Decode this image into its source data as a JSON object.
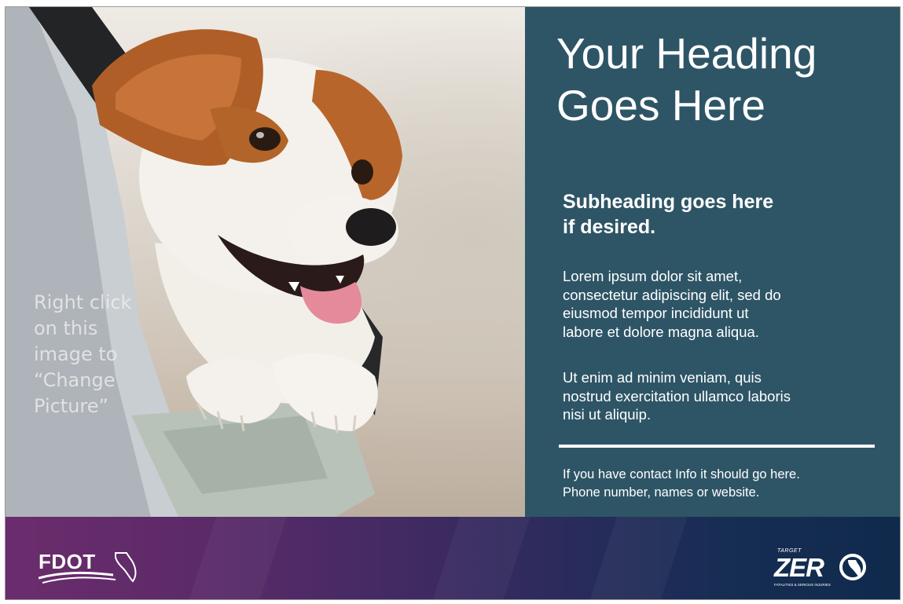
{
  "photo": {
    "alt": "Dog looking out of a car window",
    "hint": "Right click\non this\nimage to\n“Change\nPicture”"
  },
  "panel": {
    "heading": "Your Heading\nGoes Here",
    "subheading": "Subheading goes here\nif desired.",
    "paragraphs": [
      "Lorem ipsum dolor sit amet,\nconsectetur adipiscing elit, sed do\neiusmod tempor incididunt ut\nlabore et dolore magna aliqua.",
      "Ut enim ad minim veniam, quis\nnostrud exercitation ullamco laboris\nnisi ut aliquip."
    ],
    "contact": "If you have contact Info it should go here.\nPhone number, names or website."
  },
  "footer": {
    "left_logo": "FDOT",
    "right_logo": {
      "small": "TARGET",
      "main": "ZER",
      "sub": "FATALITIES & SERIOUS INJURIES"
    }
  },
  "colors": {
    "panel": "#2e5566",
    "footer_left": "#6b2c6c",
    "footer_right": "#0f2a4c",
    "text": "#ffffff"
  },
  "icons": [
    "florida-state-icon",
    "florida-state-icon"
  ]
}
